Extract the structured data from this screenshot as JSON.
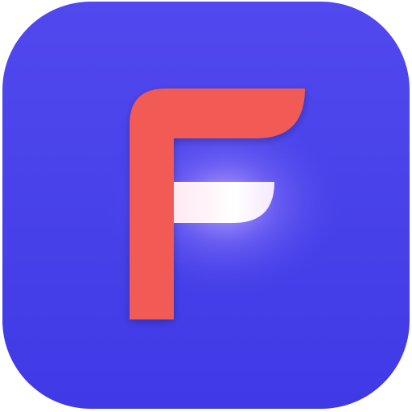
{
  "app_icon": {
    "name": "f-logo-icon",
    "colors": {
      "background_top": "#5149ee",
      "background_bottom": "#3f3ae6",
      "glyph": "#f25a57",
      "glyph_highlight": "#fff0f6",
      "glow": "#c7b3ff"
    }
  }
}
